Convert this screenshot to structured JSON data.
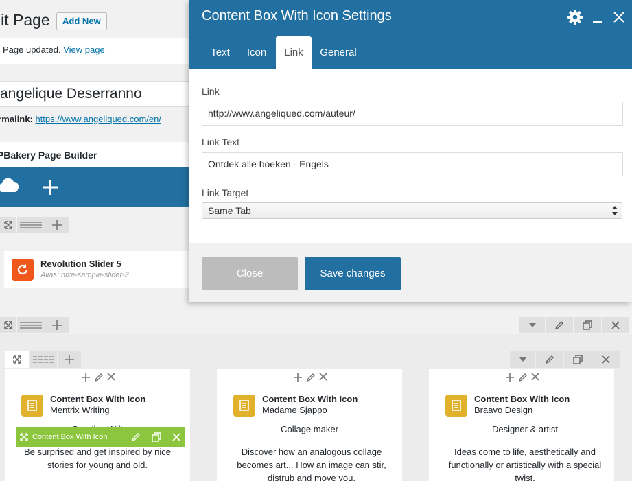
{
  "background": {
    "page_title": "lit Page",
    "add_new_label": "Add New",
    "notice_text": "Page updated.",
    "notice_link": "View page",
    "post_title": "angelique Deserranno",
    "permalink_label": "ermalink:",
    "permalink_url": "https://www.angeliqued.com/en/",
    "builder_title": "/PBakery Page Builder",
    "revolution": {
      "title": "Revolution Slider 5",
      "alias": "Alias: nixe-sample-slider-3"
    },
    "columns": [
      {
        "title": "Content Box With Icon",
        "subtitle": "Mentrix Writing",
        "heading": "Creative Writ",
        "text": "Be surprised and get inspired by nice stories for young and old."
      },
      {
        "title": "Content Box With Icon",
        "subtitle": "Madame Sjappo",
        "heading": "Collage maker",
        "text": "Discover how an analogous collage becomes art... How an image can stir, distrub and move you."
      },
      {
        "title": "Content Box With Icon",
        "subtitle": "Braavo Design",
        "heading": "Designer & artist",
        "text": "Ideas come to life, aesthetically and functionally or artistically with a special twist."
      }
    ],
    "green_bar_label": "Content Box With Icon"
  },
  "modal": {
    "title": "Content Box With Icon Settings",
    "tabs": [
      "Text",
      "Icon",
      "Link",
      "General"
    ],
    "active_tab": "Link",
    "fields": {
      "link_label": "Link",
      "link_value": "http://www.angeliqued.com/auteur/",
      "link_text_label": "Link Text",
      "link_text_value": "Ontdek alle boeken - Engels",
      "link_target_label": "Link Target",
      "link_target_value": "Same Tab"
    },
    "close_label": "Close",
    "save_label": "Save changes"
  },
  "colors": {
    "header_blue": "#2270a1",
    "save_blue": "#2270a1",
    "close_gray": "#bcbcbc",
    "revolution_orange": "#f0571b",
    "content_box_gold": "#e2b12c",
    "element_green": "#8cc63f",
    "link_blue": "#0073aa"
  },
  "icons": [
    "gear-icon",
    "minimize-icon",
    "close-icon",
    "expand-icon",
    "drag-icon",
    "plus-icon",
    "pencil-icon",
    "clone-icon",
    "delete-icon",
    "chevron-down-icon",
    "cloud-icon",
    "refresh-icon",
    "document-icon"
  ]
}
